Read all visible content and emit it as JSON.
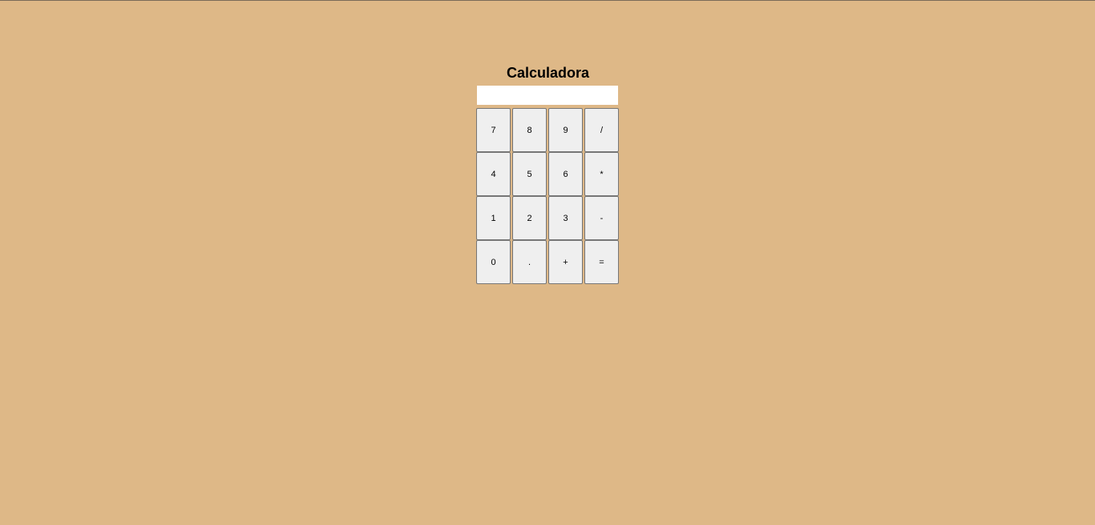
{
  "title": "Calculadora",
  "display": {
    "value": ""
  },
  "keys": {
    "row1": [
      "7",
      "8",
      "9",
      "/"
    ],
    "row2": [
      "4",
      "5",
      "6",
      "*"
    ],
    "row3": [
      "1",
      "2",
      "3",
      "-"
    ],
    "row4": [
      "0",
      ".",
      "+",
      "="
    ]
  },
  "colors": {
    "background": "#deb887",
    "key_face": "#efefef",
    "key_border": "#767676",
    "display": "#ffffff"
  }
}
